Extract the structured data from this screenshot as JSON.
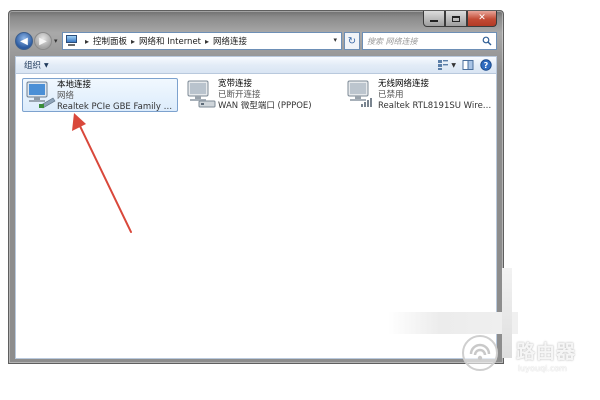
{
  "address": {
    "breadcrumbs": [
      "控制面板",
      "网络和 Internet",
      "网络连接"
    ],
    "search_placeholder": "搜索 网络连接"
  },
  "toolbar": {
    "organize_label": "组织"
  },
  "connections": [
    {
      "name": "本地连接",
      "status": "网络",
      "device": "Realtek PCIe GBE Family Contr...",
      "selected": true
    },
    {
      "name": "宽带连接",
      "status": "已断开连接",
      "device": "WAN 微型端口 (PPPOE)",
      "selected": false
    },
    {
      "name": "无线网络连接",
      "status": "已禁用",
      "device": "Realtek RTL8191SU Wireless L...",
      "selected": false
    }
  ],
  "watermark": {
    "title": "路由器",
    "url": "luyouqi.com"
  },
  "colors": {
    "annotation_arrow": "#d9483b",
    "selection_border": "#7da2ce",
    "window_frame": "#8d8d8d"
  },
  "icons": {
    "nav_back": "arrow-left-icon",
    "nav_forward": "arrow-right-icon",
    "refresh": "refresh-icon",
    "search": "search-icon",
    "view": "view-options-icon",
    "preview": "preview-pane-icon",
    "help": "help-icon"
  }
}
